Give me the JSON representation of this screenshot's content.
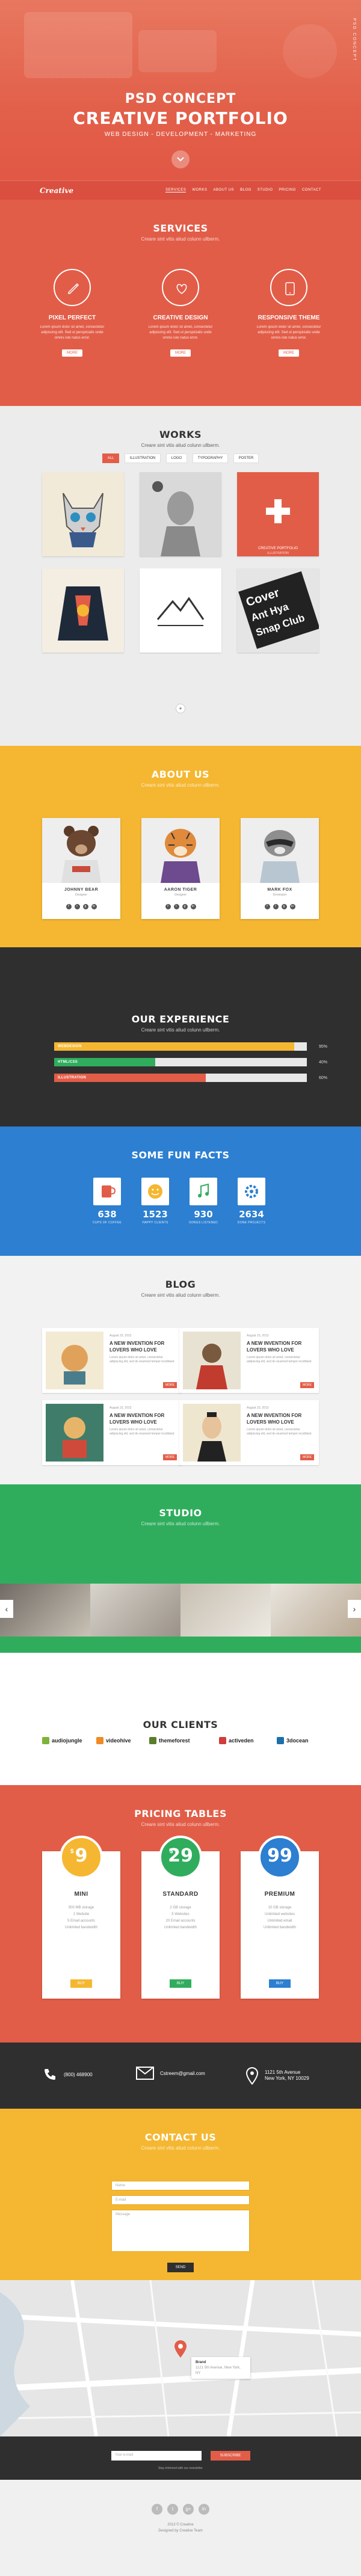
{
  "hero": {
    "title_line1": "PSD CONCEPT",
    "title_line2": "CREATIVE PORTFOLIO",
    "tagline": "WEB DESIGN - DEVELOPMENT - MARKETING",
    "vertical_text": "PSD CONCEPT"
  },
  "nav": {
    "logo": "Creative",
    "items": [
      "SERVICES",
      "WORKS",
      "ABOUT US",
      "BLOG",
      "STUDIO",
      "PRICING",
      "CONTACT"
    ]
  },
  "services": {
    "title": "SERVICES",
    "subtitle": "Creare sint vitis aliud colunn ullberm.",
    "items": [
      {
        "icon": "pencil-icon",
        "name": "PIXEL PERFECT",
        "desc": "Lorem ipsum dolor sit amet, consectetur adipiscing elit. Sed ut perspiciatis unde omnis iste natus error.",
        "button": "MORE"
      },
      {
        "icon": "heart-icon",
        "name": "CREATIVE DESIGN",
        "desc": "Lorem ipsum dolor sit amet, consectetur adipiscing elit. Sed ut perspiciatis unde omnis iste natus error.",
        "button": "MORE"
      },
      {
        "icon": "tablet-icon",
        "name": "RESPONSIVE THEME",
        "desc": "Lorem ipsum dolor sit amet, consectetur adipiscing elit. Sed ut perspiciatis unde omnis iste natus error.",
        "button": "MORE"
      }
    ]
  },
  "works": {
    "title": "WORKS",
    "subtitle": "Creare sint vitis aliud colunn ullberm.",
    "filters": [
      "ALL",
      "ILLUSTRATION",
      "LOGO",
      "TYPOGRAPHY",
      "POSTER"
    ],
    "active_filter": "ALL",
    "featured_caption": "CREATIVE PORTFOLIO",
    "featured_sub": "ILLUSTRATION",
    "poster_text": [
      "Cover",
      "Ant Hya",
      "Snap Club"
    ],
    "more": "+"
  },
  "about": {
    "title": "ABOUT US",
    "subtitle": "Creare sint vitis aliud colunn ullberm.",
    "members": [
      {
        "name": "JOHNNY BEAR",
        "role": "Designer"
      },
      {
        "name": "AARON TIGER",
        "role": "Designer"
      },
      {
        "name": "MARK FOX",
        "role": "Developer"
      }
    ]
  },
  "experience": {
    "title": "OUR EXPERIENCE",
    "subtitle": "Creare sint vitis aliud colunn ullberm.",
    "skills": [
      {
        "label": "WEBDESIGN",
        "percent": 95,
        "pct_text": "95%",
        "color": "#f5b731"
      },
      {
        "label": "HTML/CSS",
        "percent": 40,
        "pct_text": "40%",
        "color": "#2fad5d"
      },
      {
        "label": "ILLUSTRATION",
        "percent": 60,
        "pct_text": "60%",
        "color": "#e25d48"
      }
    ]
  },
  "funfacts": {
    "title": "SOME FUN FACTS",
    "facts": [
      {
        "icon": "coffee-icon",
        "number": "638",
        "label": "CUPS OF COFFEE"
      },
      {
        "icon": "smile-icon",
        "number": "1523",
        "label": "HAPPY CLIENTS"
      },
      {
        "icon": "music-icon",
        "number": "930",
        "label": "SONGS LISTENED"
      },
      {
        "icon": "gear-icon",
        "number": "2634",
        "label": "DONE PROJECTS"
      }
    ]
  },
  "blog": {
    "title": "BLOG",
    "subtitle": "Creare sint vitis aliud colunn ullberm.",
    "posts": [
      {
        "date": "August 23, 2013",
        "title": "A NEW INVENTION FOR LOVERS WHO LOVE",
        "excerpt": "Lorem ipsum dolor sit amet, consectetur adipiscing elit, sed do eiusmod tempor incididunt.",
        "button": "MORE"
      },
      {
        "date": "August 23, 2013",
        "title": "A NEW INVENTION FOR LOVERS WHO LOVE",
        "excerpt": "Lorem ipsum dolor sit amet, consectetur adipiscing elit, sed do eiusmod tempor incididunt.",
        "button": "MORE"
      },
      {
        "date": "August 23, 2013",
        "title": "A NEW INVENTION FOR LOVERS WHO LOVE",
        "excerpt": "Lorem ipsum dolor sit amet, consectetur adipiscing elit, sed do eiusmod tempor incididunt.",
        "button": "MORE"
      },
      {
        "date": "August 23, 2013",
        "title": "A NEW INVENTION FOR LOVERS WHO LOVE",
        "excerpt": "Lorem ipsum dolor sit amet, consectetur adipiscing elit, sed do eiusmod tempor incididunt.",
        "button": "MORE"
      }
    ]
  },
  "studio": {
    "title": "STUDIO",
    "subtitle": "Creare sint vitis aliud colunn ullberm.",
    "prev": "‹",
    "next": "›"
  },
  "clients": {
    "title": "OUR CLIENTS",
    "items": [
      {
        "name": "audiojungle",
        "color": "#7fb23a"
      },
      {
        "name": "videohive",
        "color": "#f08a24"
      },
      {
        "name": "themeforest",
        "color": "#5a7d2a"
      },
      {
        "name": "activeden",
        "color": "#d23c3c"
      },
      {
        "name": "3docean",
        "color": "#1c6fa9"
      }
    ]
  },
  "pricing": {
    "title": "PRICING TABLES",
    "subtitle": "Creare sint vitis aliud colunn ullberm.",
    "plans": [
      {
        "name": "MINI",
        "currency": "$",
        "price": "9",
        "color": "#f5b731",
        "features": [
          "500 MB storage",
          "1 Website",
          "5 Email accounts",
          "Unlimited bandwidth"
        ],
        "button": "BUY"
      },
      {
        "name": "STANDARD",
        "currency": "$",
        "price": "29",
        "color": "#2fad5d",
        "features": [
          "2 GB storage",
          "5 Websites",
          "20 Email accounts",
          "Unlimited bandwidth"
        ],
        "button": "BUY"
      },
      {
        "name": "PREMIUM",
        "currency": "$",
        "price": "99",
        "color": "#2c7fd1",
        "features": [
          "10 GB storage",
          "Unlimited websites",
          "Unlimited email",
          "Unlimited bandwidth"
        ],
        "button": "BUY"
      }
    ]
  },
  "contactbar": {
    "phone": "(800) 468900",
    "email": "Cstreem@gmail.com",
    "address_line1": "1121 5th Avenue",
    "address_line2": "New York, NY 10029"
  },
  "contact": {
    "title": "CONTACT US",
    "subtitle": "Creare sint vitis aliud colunn ullberm.",
    "name_placeholder": "Name",
    "email_placeholder": "E-mail",
    "message_placeholder": "Message",
    "send": "SEND"
  },
  "map": {
    "pin_title": "Brand",
    "pin_address": "1121 5th Avenue, New York, NY"
  },
  "newsletter": {
    "placeholder": "Your e-mail",
    "button": "SUBSCRIBE",
    "note": "Stay informed with our newsletter"
  },
  "footer": {
    "social": [
      "f",
      "t",
      "g+",
      "in"
    ],
    "copyright": "2013 © Creative",
    "credit": "Designed by Creative Team"
  }
}
